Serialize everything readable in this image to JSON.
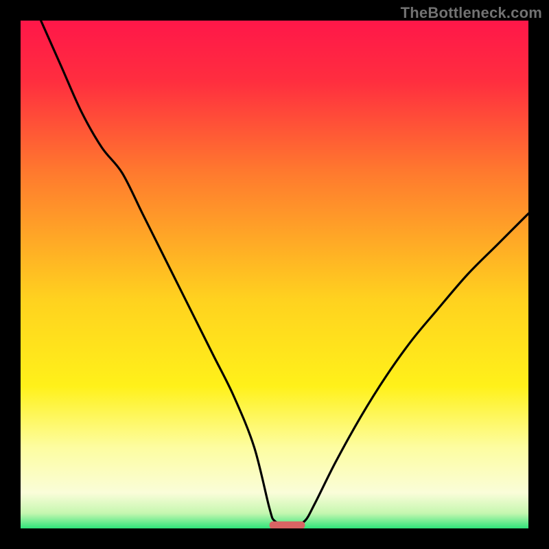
{
  "watermark": "TheBottleneck.com",
  "colors": {
    "frame": "#000000",
    "marker": "#d96464",
    "curve": "#000000",
    "gradient_stops": [
      {
        "offset": 0,
        "color": "#ff1749"
      },
      {
        "offset": 12,
        "color": "#ff2e3f"
      },
      {
        "offset": 30,
        "color": "#ff7a2e"
      },
      {
        "offset": 55,
        "color": "#ffd21f"
      },
      {
        "offset": 72,
        "color": "#fff11a"
      },
      {
        "offset": 84,
        "color": "#fdfda0"
      },
      {
        "offset": 93,
        "color": "#fafdd9"
      },
      {
        "offset": 97,
        "color": "#c6f7b0"
      },
      {
        "offset": 100,
        "color": "#2fe47a"
      }
    ]
  },
  "chart_data": {
    "type": "line",
    "title": "",
    "xlabel": "",
    "ylabel": "",
    "xlim": [
      0,
      100
    ],
    "ylim": [
      0,
      100
    ],
    "notch_center_x": 52,
    "marker": {
      "x0": 49,
      "x1": 56,
      "y": 0.7
    },
    "series": [
      {
        "name": "bottleneck-curve",
        "x": [
          4,
          8,
          12,
          16,
          20,
          24,
          28,
          34,
          38,
          42,
          46,
          49,
          50,
          52,
          54,
          56,
          58,
          62,
          67,
          72,
          77,
          82,
          88,
          94,
          100
        ],
        "y": [
          100,
          91,
          82,
          75,
          70,
          62,
          54,
          42,
          34,
          26,
          16,
          4,
          1.5,
          0.8,
          0.8,
          1.5,
          5,
          13,
          22,
          30,
          37,
          43,
          50,
          56,
          62
        ]
      }
    ]
  }
}
